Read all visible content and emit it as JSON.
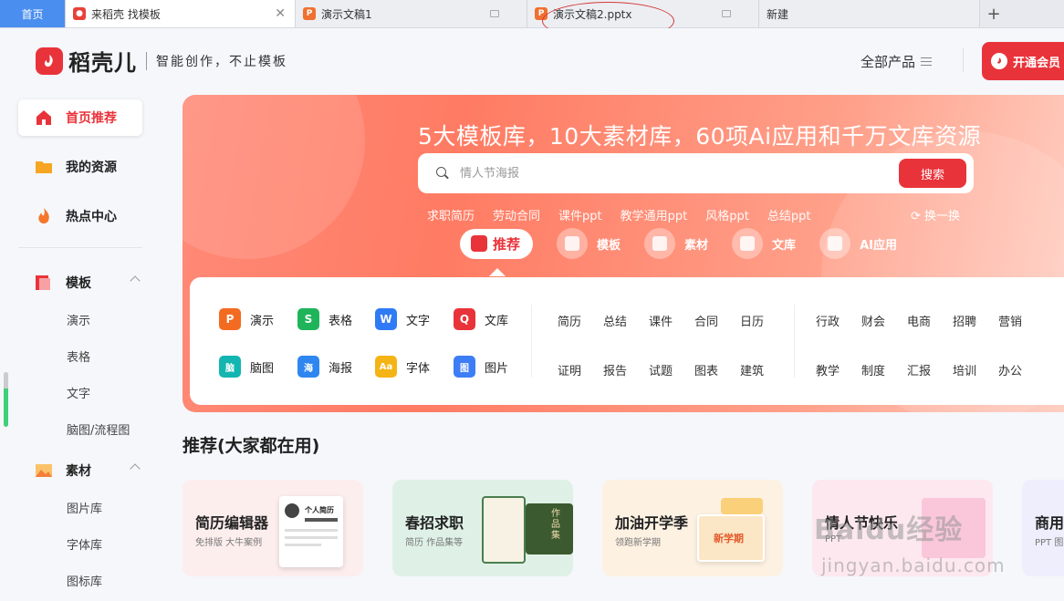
{
  "tabs": [
    {
      "label": "首页",
      "type": "home"
    },
    {
      "label": "来稻壳 找模板",
      "type": "active"
    },
    {
      "label": "演示文稿1",
      "type": "doc"
    },
    {
      "label": "演示文稿2.pptx",
      "type": "doc"
    },
    {
      "label": "新建",
      "type": "new"
    }
  ],
  "header": {
    "brand": "稻壳儿",
    "slogan": "智能创作，不止模板",
    "all_products": "全部产品",
    "vip": "开通会员"
  },
  "sidebar": {
    "main": [
      "首页推荐",
      "我的资源",
      "热点中心"
    ],
    "groups": [
      {
        "label": "模板",
        "items": [
          "演示",
          "表格",
          "文字",
          "脑图/流程图"
        ]
      },
      {
        "label": "素材",
        "items": [
          "图片库",
          "字体库",
          "图标库"
        ]
      }
    ]
  },
  "banner": {
    "headline": "5大模板库，10大素材库，60项Ai应用和千万文库资源",
    "search_placeholder": "情人节海报",
    "search_button": "搜索",
    "hot_tags": [
      "求职简历",
      "劳动合同",
      "课件ppt",
      "教学通用ppt",
      "风格ppt",
      "总结ppt"
    ],
    "refresh": "换一换",
    "categories": [
      "推荐",
      "模板",
      "素材",
      "文库",
      "AI应用"
    ]
  },
  "tools": [
    {
      "label": "演示",
      "color": "#f36b21",
      "glyph": "P"
    },
    {
      "label": "表格",
      "color": "#1fb45a",
      "glyph": "S"
    },
    {
      "label": "文字",
      "color": "#2f7bf5",
      "glyph": "W"
    },
    {
      "label": "文库",
      "color": "#e9333a",
      "glyph": "Q"
    },
    {
      "label": "脑图",
      "color": "#13b5b1",
      "glyph": "脑"
    },
    {
      "label": "海报",
      "color": "#2f86f0",
      "glyph": "海"
    },
    {
      "label": "字体",
      "color": "#f5b416",
      "glyph": "Aa"
    },
    {
      "label": "图片",
      "color": "#3d7df5",
      "glyph": "图"
    }
  ],
  "keywords": {
    "col1": [
      [
        "简历",
        "总结",
        "课件",
        "合同",
        "日历"
      ],
      [
        "证明",
        "报告",
        "试题",
        "图表",
        "建筑"
      ]
    ],
    "col2": [
      [
        "行政",
        "财会",
        "电商",
        "招聘",
        "营销"
      ],
      [
        "教学",
        "制度",
        "汇报",
        "培训",
        "办公"
      ]
    ]
  },
  "recommend": {
    "title": "推荐(大家都在用)",
    "cards": [
      {
        "title": "简历编辑器",
        "sub": "免排版 大牛案例",
        "bg": "#fdeeee"
      },
      {
        "title": "春招求职",
        "sub": "简历 作品集等",
        "bg": "#dff1e6"
      },
      {
        "title": "加油开学季",
        "sub": "领跑新学期",
        "bg": "#fdf1e2"
      },
      {
        "title": "情人节快乐",
        "sub": "PPT",
        "bg": "#fde8ef"
      },
      {
        "title": "商用",
        "sub": "PPT 图",
        "bg": "#eeeefd"
      }
    ]
  },
  "card_art": {
    "resume": "个人简历",
    "spring": "作品集",
    "school": "新学期"
  },
  "watermark": {
    "text": "Baidu经验",
    "url": "jingyan.baidu.com"
  }
}
